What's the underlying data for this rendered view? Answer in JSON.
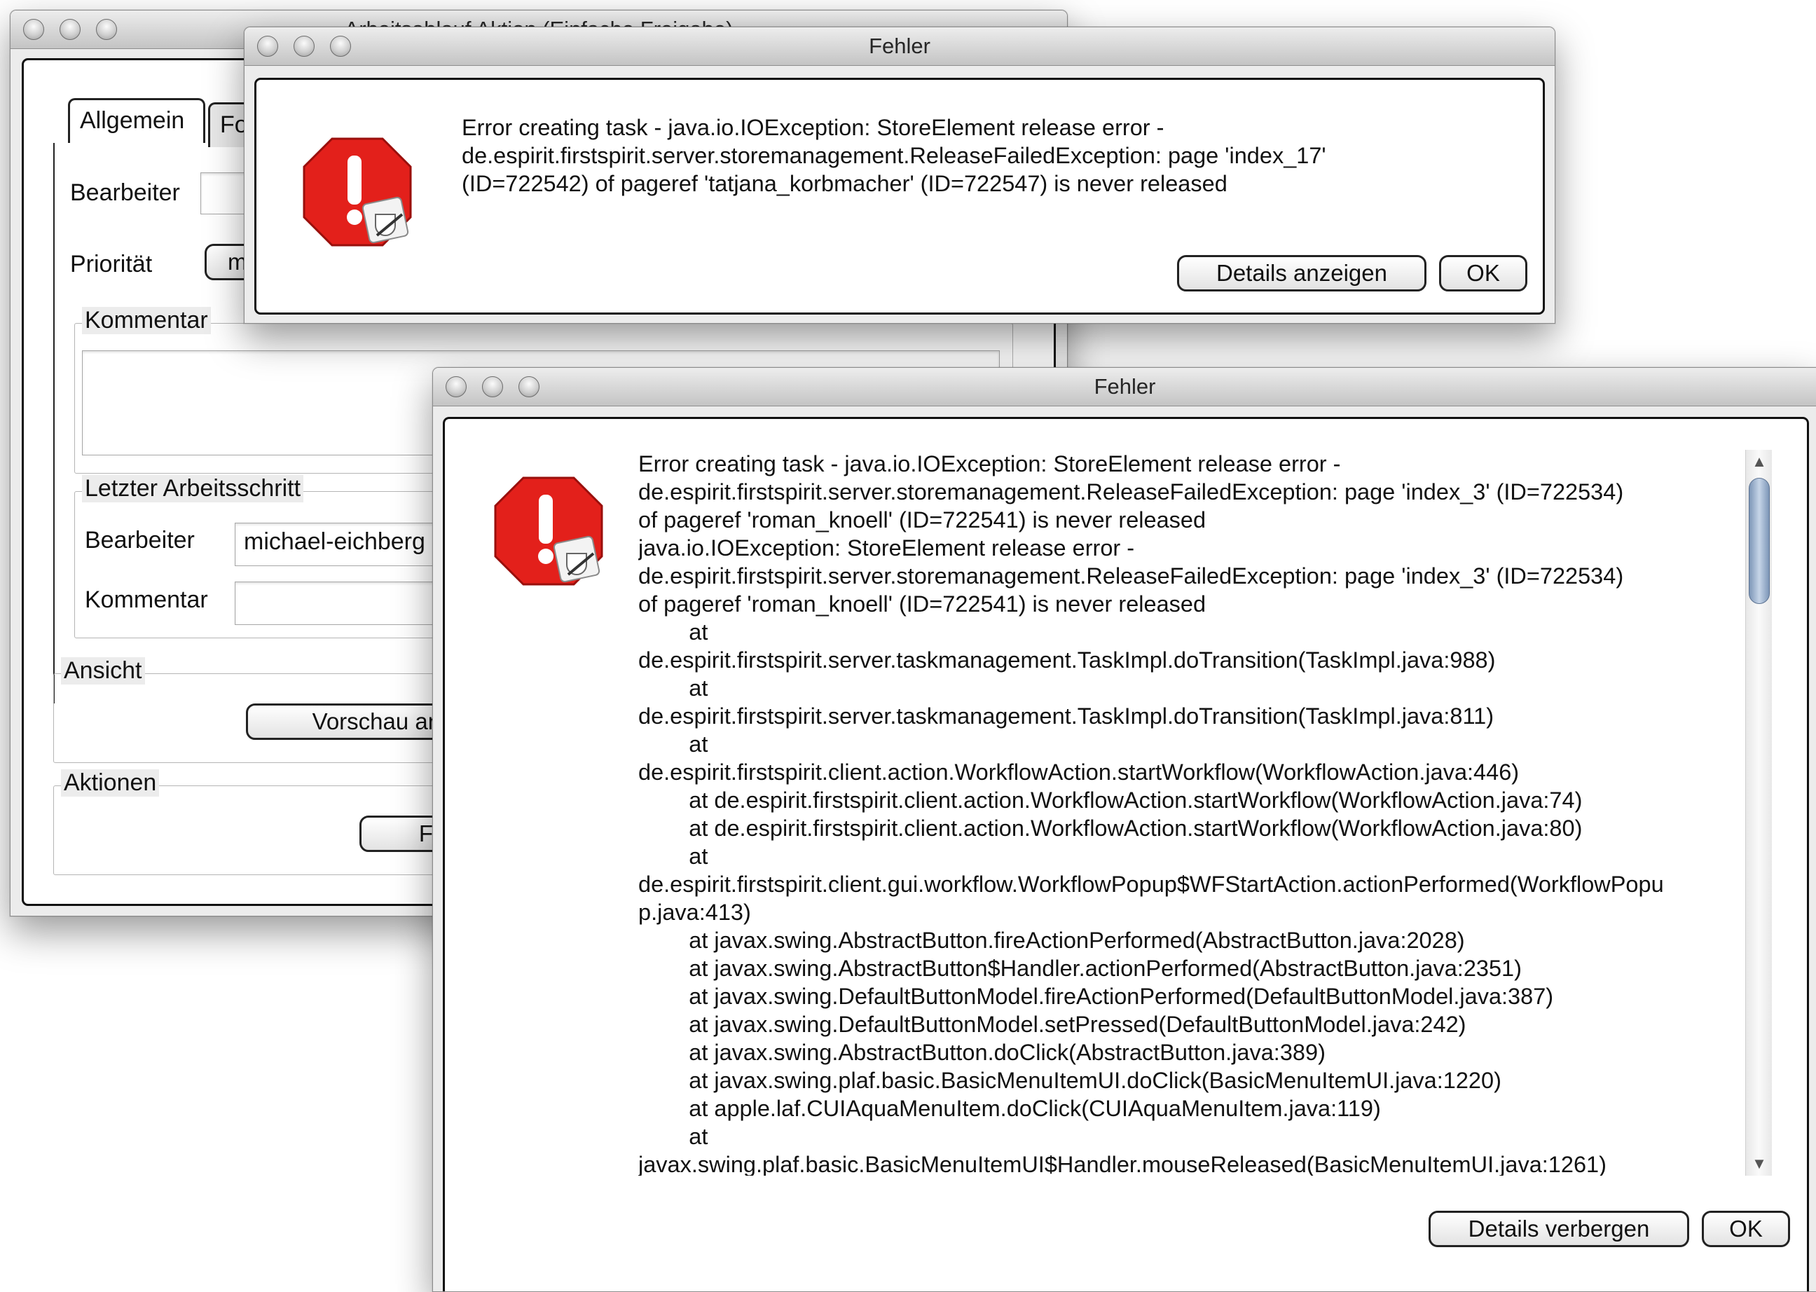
{
  "background_window": {
    "title": "Arbeitsablauf Aktion (Einfache Freigabe)",
    "tabs": [
      "Allgemein",
      "Fo"
    ],
    "bearbeiter_label": "Bearbeiter",
    "prioritaet_label": "Priorität",
    "prioritaet_value": "mi",
    "kommentar_group": "Kommentar",
    "letzter_group": "Letzter Arbeitsschritt",
    "letzter_bearbeiter_label": "Bearbeiter",
    "letzter_bearbeiter_value": "michael-eichberg",
    "letzter_kommentar_label": "Kommentar",
    "ansicht_group": "Ansicht",
    "vorschau_button": "Vorschau anzeigen",
    "aktionen_group": "Aktionen",
    "freigabe_button": "Freigabe"
  },
  "dialog_small": {
    "title": "Fehler",
    "message_lines": [
      "Error creating task - java.io.IOException: StoreElement release error -",
      "de.espirit.firstspirit.server.storemanagement.ReleaseFailedException: page 'index_17'",
      "(ID=722542) of pageref 'tatjana_korbmacher' (ID=722547) is never released"
    ],
    "details_button": "Details anzeigen",
    "ok_button": "OK"
  },
  "dialog_large": {
    "title": "Fehler",
    "message_lines": [
      "Error creating task - java.io.IOException: StoreElement release error -",
      "de.espirit.firstspirit.server.storemanagement.ReleaseFailedException: page 'index_3' (ID=722534)",
      "of pageref 'roman_knoell' (ID=722541) is never released",
      "",
      "java.io.IOException: StoreElement release error -",
      "de.espirit.firstspirit.server.storemanagement.ReleaseFailedException: page 'index_3' (ID=722534)",
      "of pageref 'roman_knoell' (ID=722541) is never released",
      "\t\tat",
      "de.espirit.firstspirit.server.taskmanagement.TaskImpl.doTransition(TaskImpl.java:988)",
      "\t\tat",
      "de.espirit.firstspirit.server.taskmanagement.TaskImpl.doTransition(TaskImpl.java:811)",
      "\t\tat",
      "de.espirit.firstspirit.client.action.WorkflowAction.startWorkflow(WorkflowAction.java:446)",
      "\t\tat de.espirit.firstspirit.client.action.WorkflowAction.startWorkflow(WorkflowAction.java:74)",
      "\t\tat de.espirit.firstspirit.client.action.WorkflowAction.startWorkflow(WorkflowAction.java:80)",
      "\t\tat",
      "de.espirit.firstspirit.client.gui.workflow.WorkflowPopup$WFStartAction.actionPerformed(WorkflowPopu",
      "p.java:413)",
      "\t\tat javax.swing.AbstractButton.fireActionPerformed(AbstractButton.java:2028)",
      "\t\tat javax.swing.AbstractButton$Handler.actionPerformed(AbstractButton.java:2351)",
      "\t\tat javax.swing.DefaultButtonModel.fireActionPerformed(DefaultButtonModel.java:387)",
      "\t\tat javax.swing.DefaultButtonModel.setPressed(DefaultButtonModel.java:242)",
      "\t\tat javax.swing.AbstractButton.doClick(AbstractButton.java:389)",
      "\t\tat javax.swing.plaf.basic.BasicMenuItemUI.doClick(BasicMenuItemUI.java:1220)",
      "\t\tat apple.laf.CUIAquaMenuItem.doClick(CUIAquaMenuItem.java:119)",
      "\t\tat",
      "javax.swing.plaf.basic.BasicMenuItemUI$Handler.mouseReleased(BasicMenuItemUI.java:1261)"
    ],
    "details_button": "Details verbergen",
    "ok_button": "OK"
  },
  "icons": {
    "error_icon": "stop-sign-with-exclamation-and-java-cup",
    "scroll_up": "▲",
    "scroll_down": "▼"
  },
  "colors": {
    "error_red": "#e3201b",
    "scroll_thumb": "#9fb4cf"
  }
}
